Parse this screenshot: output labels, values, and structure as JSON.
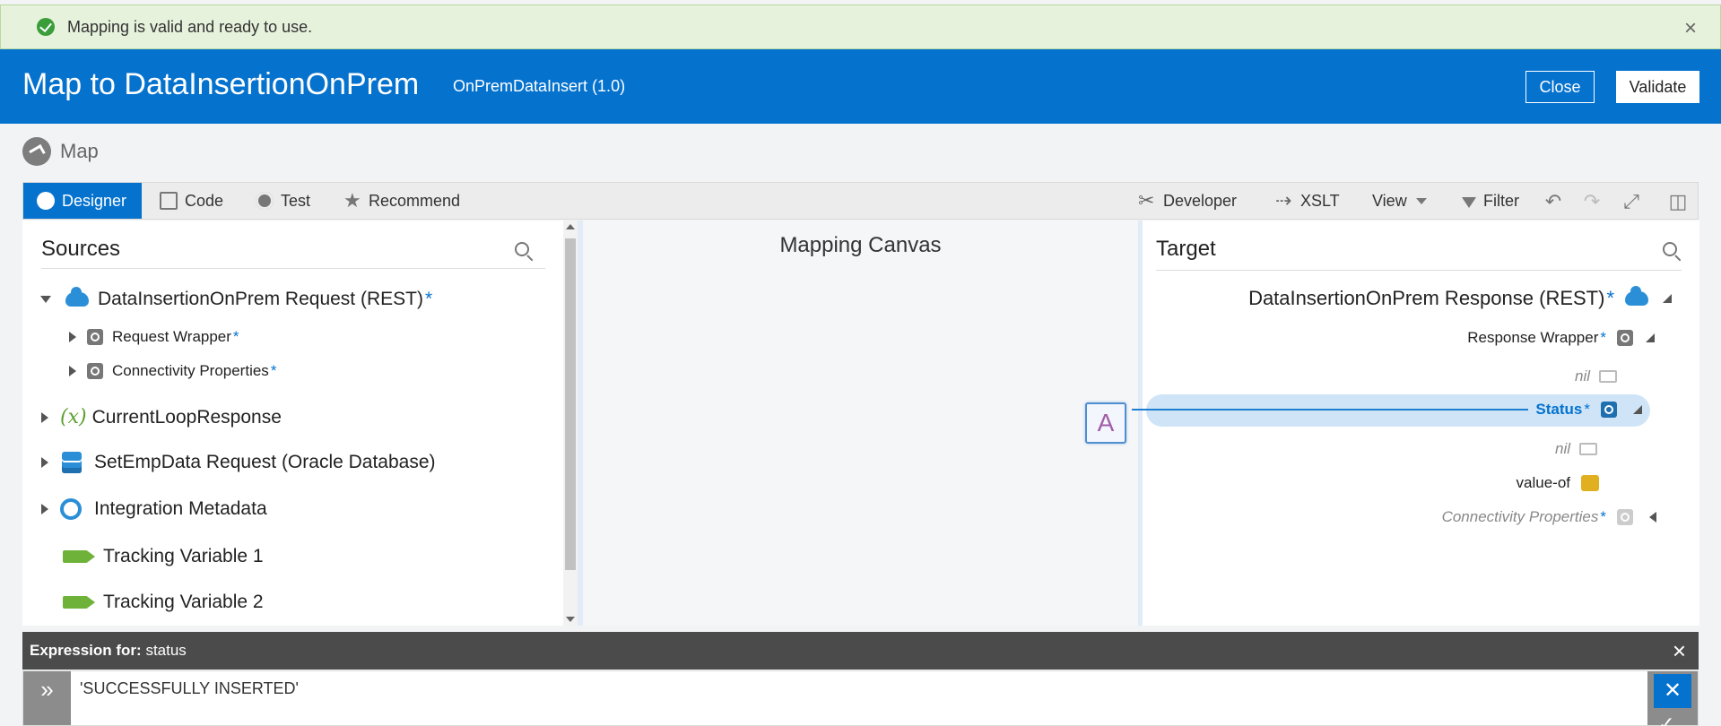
{
  "banner": {
    "message": "Mapping is valid and ready to use.",
    "close": "×"
  },
  "header": {
    "title": "Map to DataInsertionOnPrem",
    "subtitle": "OnPremDataInsert (1.0)",
    "close_label": "Close",
    "validate_label": "Validate",
    "bg_color": "#0572ce"
  },
  "map_label": "Map",
  "toolbar": {
    "designer": "Designer",
    "code": "Code",
    "test": "Test",
    "recommend": "Recommend",
    "developer": "Developer",
    "xslt": "XSLT",
    "view": "View",
    "filter": "Filter"
  },
  "sources": {
    "title": "Sources",
    "items": [
      {
        "label": "DataInsertionOnPrem Request (REST)",
        "required": "*",
        "icon": "cloud-icon"
      },
      {
        "label": "Request Wrapper",
        "required": "*",
        "icon": "element-icon"
      },
      {
        "label": "Connectivity Properties",
        "required": "*",
        "icon": "element-icon"
      },
      {
        "label": "CurrentLoopResponse",
        "icon": "variable-icon",
        "glyph": "(x)"
      },
      {
        "label": "SetEmpData Request (Oracle Database)",
        "icon": "database-icon"
      },
      {
        "label": "Integration Metadata",
        "icon": "metadata-icon"
      },
      {
        "label": "Tracking Variable 1",
        "icon": "tracking-icon"
      },
      {
        "label": "Tracking Variable 2",
        "icon": "tracking-icon"
      }
    ]
  },
  "canvas": {
    "title": "Mapping Canvas",
    "node_label": "A"
  },
  "target": {
    "title": "Target",
    "items": [
      {
        "label": "DataInsertionOnPrem Response (REST)",
        "required": "*"
      },
      {
        "label": "Response Wrapper",
        "required": "*"
      },
      {
        "label": "nil"
      },
      {
        "label": "Status",
        "required": "*"
      },
      {
        "label": "nil"
      },
      {
        "label": "value-of"
      },
      {
        "label": "Connectivity Properties",
        "required": "*"
      }
    ]
  },
  "expression": {
    "label": "Expression for:",
    "field": "status",
    "value": "'SUCCESSFULLY INSERTED'",
    "gutter_glyph": "»",
    "tool_glyph": "✕",
    "check_glyph": "✓",
    "close_glyph": "×"
  }
}
